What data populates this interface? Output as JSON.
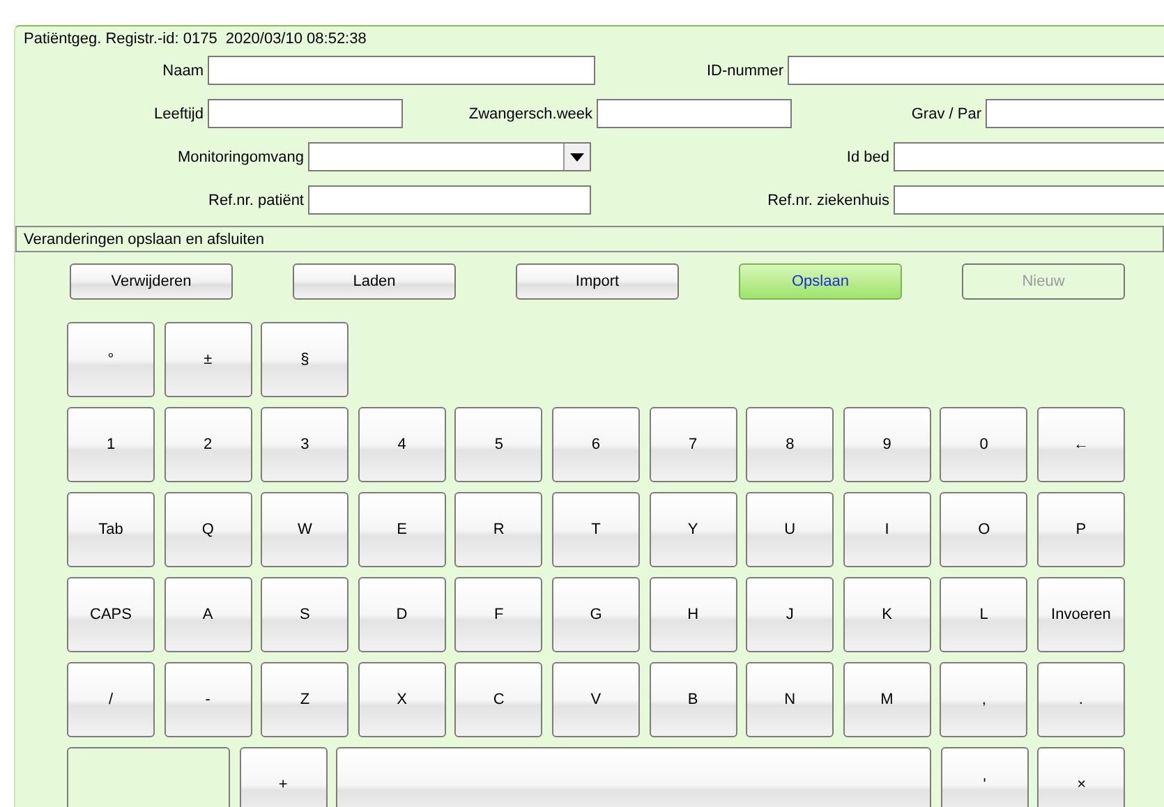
{
  "panel": {
    "title": "Patiëntgeg. Registr.-id: 0175  2020/03/10 08:52:38"
  },
  "form_rows": [
    [
      {
        "label": "Naam",
        "kind": "text"
      },
      {
        "label": "ID-nummer",
        "kind": "text"
      }
    ],
    [
      {
        "label": "Leeftijd",
        "kind": "text"
      },
      {
        "label": "Zwangersch.week",
        "kind": "text"
      },
      {
        "label": "Grav / Par",
        "kind": "text"
      }
    ],
    [
      {
        "label": "Monitoringomvang",
        "kind": "select"
      },
      {
        "label": "Id bed",
        "kind": "text"
      }
    ],
    [
      {
        "label": "Ref.nr. patiënt",
        "kind": "text"
      },
      {
        "label": "Ref.nr. ziekenhuis",
        "kind": "text"
      }
    ]
  ],
  "status_bar": "Veranderingen opslaan en afsluiten",
  "buttons": [
    {
      "label": "Verwijderen",
      "highlighted": false,
      "disabled": false
    },
    {
      "label": "Laden",
      "highlighted": false,
      "disabled": false
    },
    {
      "label": "Import",
      "highlighted": false,
      "disabled": false
    },
    {
      "label": "Opslaan",
      "highlighted": true,
      "disabled": false
    },
    {
      "label": "Nieuw",
      "highlighted": false,
      "disabled": true
    }
  ],
  "keyboard_rows": [
    [
      {
        "label": "°",
        "kind": "key"
      },
      {
        "label": "±",
        "kind": "key"
      },
      {
        "label": "§",
        "kind": "key"
      }
    ],
    [
      {
        "label": "1",
        "kind": "key"
      },
      {
        "label": "2",
        "kind": "key"
      },
      {
        "label": "3",
        "kind": "key"
      },
      {
        "label": "4",
        "kind": "key"
      },
      {
        "label": "5",
        "kind": "key"
      },
      {
        "label": "6",
        "kind": "key"
      },
      {
        "label": "7",
        "kind": "key"
      },
      {
        "label": "8",
        "kind": "key"
      },
      {
        "label": "9",
        "kind": "key"
      },
      {
        "label": "0",
        "kind": "key"
      },
      {
        "label": "←",
        "kind": "key"
      }
    ],
    [
      {
        "label": "Tab",
        "kind": "key"
      },
      {
        "label": "Q",
        "kind": "key"
      },
      {
        "label": "W",
        "kind": "key"
      },
      {
        "label": "E",
        "kind": "key"
      },
      {
        "label": "R",
        "kind": "key"
      },
      {
        "label": "T",
        "kind": "key"
      },
      {
        "label": "Y",
        "kind": "key"
      },
      {
        "label": "U",
        "kind": "key"
      },
      {
        "label": "I",
        "kind": "key"
      },
      {
        "label": "O",
        "kind": "key"
      },
      {
        "label": "P",
        "kind": "key"
      }
    ],
    [
      {
        "label": "CAPS",
        "kind": "key"
      },
      {
        "label": "A",
        "kind": "key"
      },
      {
        "label": "S",
        "kind": "key"
      },
      {
        "label": "D",
        "kind": "key"
      },
      {
        "label": "F",
        "kind": "key"
      },
      {
        "label": "G",
        "kind": "key"
      },
      {
        "label": "H",
        "kind": "key"
      },
      {
        "label": "J",
        "kind": "key"
      },
      {
        "label": "K",
        "kind": "key"
      },
      {
        "label": "L",
        "kind": "key"
      },
      {
        "label": "Invoeren",
        "kind": "key"
      }
    ],
    [
      {
        "label": "/",
        "kind": "key"
      },
      {
        "label": "-",
        "kind": "key"
      },
      {
        "label": "Z",
        "kind": "key"
      },
      {
        "label": "X",
        "kind": "key"
      },
      {
        "label": "C",
        "kind": "key"
      },
      {
        "label": "V",
        "kind": "key"
      },
      {
        "label": "B",
        "kind": "key"
      },
      {
        "label": "N",
        "kind": "key"
      },
      {
        "label": "M",
        "kind": "key"
      },
      {
        "label": ",",
        "kind": "key"
      },
      {
        "label": ".",
        "kind": "key"
      }
    ],
    [
      {
        "kind": "blank"
      },
      {
        "label": "+",
        "kind": "key"
      },
      {
        "kind": "space"
      },
      {
        "label": "'",
        "kind": "key"
      },
      {
        "label": "×",
        "kind": "key"
      }
    ]
  ]
}
